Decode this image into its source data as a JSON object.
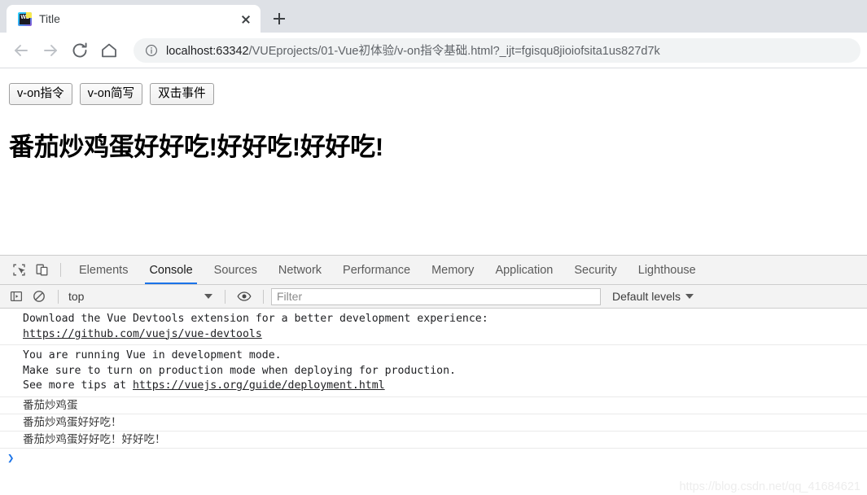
{
  "browser": {
    "tab": {
      "title": "Title",
      "favicon_name": "webstorm-favicon",
      "favicon_text": "WS",
      "close_label": "×"
    },
    "new_tab_label": "+",
    "nav": {
      "back_icon": "arrow-left-icon",
      "forward_icon": "arrow-right-icon",
      "reload_icon": "reload-icon",
      "home_icon": "home-icon"
    },
    "omnibox": {
      "info_icon": "info-circle-icon",
      "host": "localhost:63342",
      "path": "/VUEprojects/01-Vue初体验/v-on指令基础.html?_ijt=fgisqu8jioiofsita1us827d7k"
    }
  },
  "page": {
    "buttons": [
      {
        "label": "v-on指令",
        "name": "v-on-directive-button"
      },
      {
        "label": "v-on简写",
        "name": "v-on-shorthand-button"
      },
      {
        "label": "双击事件",
        "name": "dblclick-event-button"
      }
    ],
    "heading": "番茄炒鸡蛋好好吃!好好吃!好好吃!"
  },
  "devtools": {
    "inspect_icon": "inspect-element-icon",
    "device_icon": "device-toolbar-icon",
    "tabs": [
      {
        "label": "Elements",
        "active": false
      },
      {
        "label": "Console",
        "active": true
      },
      {
        "label": "Sources",
        "active": false
      },
      {
        "label": "Network",
        "active": false
      },
      {
        "label": "Performance",
        "active": false
      },
      {
        "label": "Memory",
        "active": false
      },
      {
        "label": "Application",
        "active": false
      },
      {
        "label": "Security",
        "active": false
      },
      {
        "label": "Lighthouse",
        "active": false
      }
    ],
    "console_toolbar": {
      "sidebar_icon": "console-sidebar-icon",
      "clear_icon": "clear-console-icon",
      "context": "top",
      "eye_icon": "live-expression-eye-icon",
      "filter_placeholder": "Filter",
      "filter_value": "",
      "levels_label": "Default levels"
    },
    "console_messages": [
      {
        "name": "console-message-vue-devtools",
        "text": "Download the Vue Devtools extension for a better development experience:",
        "link": "https://github.com/vuejs/vue-devtools"
      },
      {
        "name": "console-message-dev-mode",
        "line1": "You are running Vue in development mode.",
        "line2": "Make sure to turn on production mode when deploying for production.",
        "line3_prefix": "See more tips at ",
        "link": "https://vuejs.org/guide/deployment.html"
      },
      {
        "name": "console-log-1",
        "text": "番茄炒鸡蛋"
      },
      {
        "name": "console-log-2",
        "text": "番茄炒鸡蛋好好吃！"
      },
      {
        "name": "console-log-3",
        "text": "番茄炒鸡蛋好好吃！好好吃！"
      }
    ],
    "prompt_symbol": "❯"
  },
  "watermark": "https://blog.csdn.net/qq_41684621",
  "colors": {
    "accent": "#1a73e8",
    "tabstrip_bg": "#dee1e6",
    "devtools_bg": "#f3f3f3",
    "omnibox_bg": "#f1f3f4"
  }
}
